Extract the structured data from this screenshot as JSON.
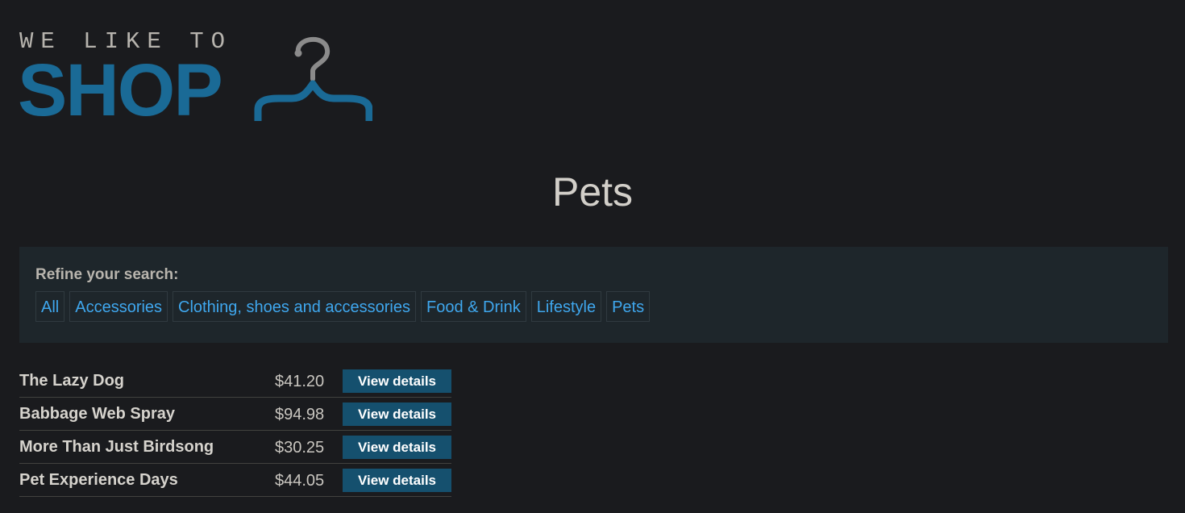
{
  "logo": {
    "tagline": "WE LIKE TO",
    "wordmark": "SHOP",
    "icon": "hanger-icon",
    "accent_color": "#1a6a96"
  },
  "page": {
    "title": "Pets"
  },
  "filters": {
    "label": "Refine your search:",
    "items": [
      {
        "label": "All"
      },
      {
        "label": "Accessories"
      },
      {
        "label": "Clothing, shoes and accessories"
      },
      {
        "label": "Food & Drink"
      },
      {
        "label": "Lifestyle"
      },
      {
        "label": "Pets"
      }
    ],
    "link_color": "#3fa7ee"
  },
  "products": [
    {
      "name": "The Lazy Dog",
      "price": "$41.20",
      "button_label": "View details"
    },
    {
      "name": "Babbage Web Spray",
      "price": "$94.98",
      "button_label": "View details"
    },
    {
      "name": "More Than Just Birdsong",
      "price": "$30.25",
      "button_label": "View details"
    },
    {
      "name": "Pet Experience Days",
      "price": "$44.05",
      "button_label": "View details"
    }
  ],
  "colors": {
    "background": "#1a1b1e",
    "panel": "#1e262b",
    "button": "#15506e"
  }
}
